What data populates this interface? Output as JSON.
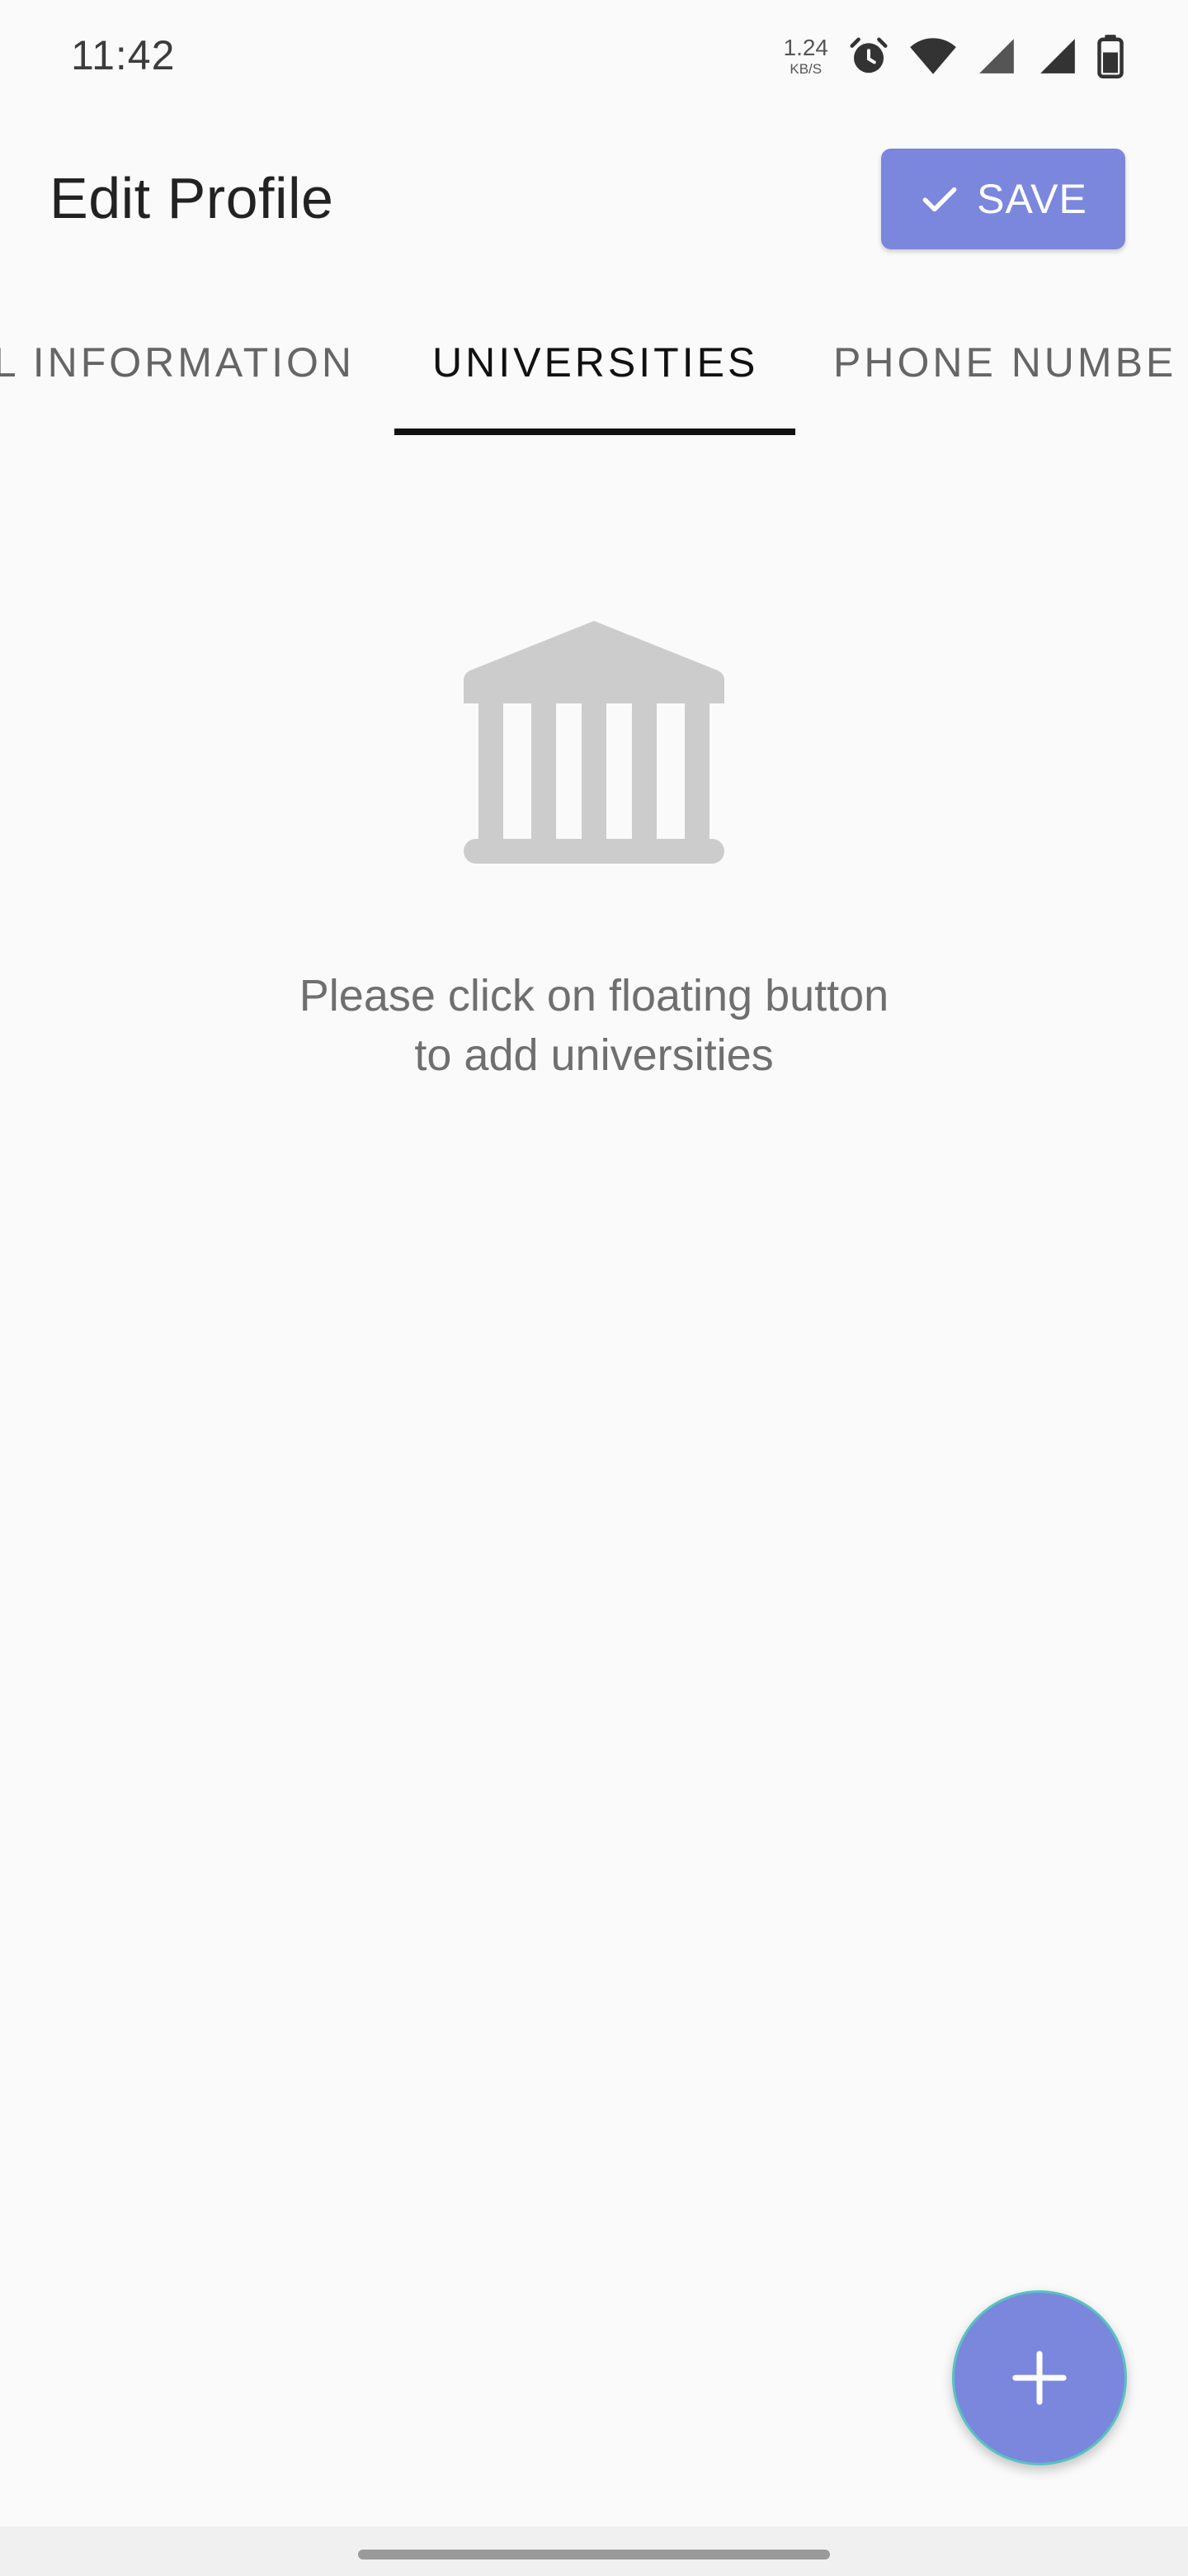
{
  "status_bar": {
    "time": "11:42",
    "net_speed_value": "1.24",
    "net_speed_unit": "KB/S",
    "icons": [
      "alarm-icon",
      "wifi-icon",
      "signal-icon",
      "signal-icon",
      "battery-icon"
    ]
  },
  "app_bar": {
    "title": "Edit Profile",
    "save_label": "SAVE",
    "save_icon": "check-icon"
  },
  "tabs": [
    {
      "label": "L INFORMATION",
      "selected": false
    },
    {
      "label": "UNIVERSITIES",
      "selected": true
    },
    {
      "label": "PHONE NUMBE",
      "selected": false
    }
  ],
  "empty_state": {
    "icon": "university-icon",
    "line1": "Please click on floating button",
    "line2": "to add universities"
  },
  "fab": {
    "icon": "plus-icon"
  },
  "colors": {
    "accent": "#7b87dd",
    "fab_border": "#55c4c0",
    "empty_icon": "#cccccc"
  }
}
